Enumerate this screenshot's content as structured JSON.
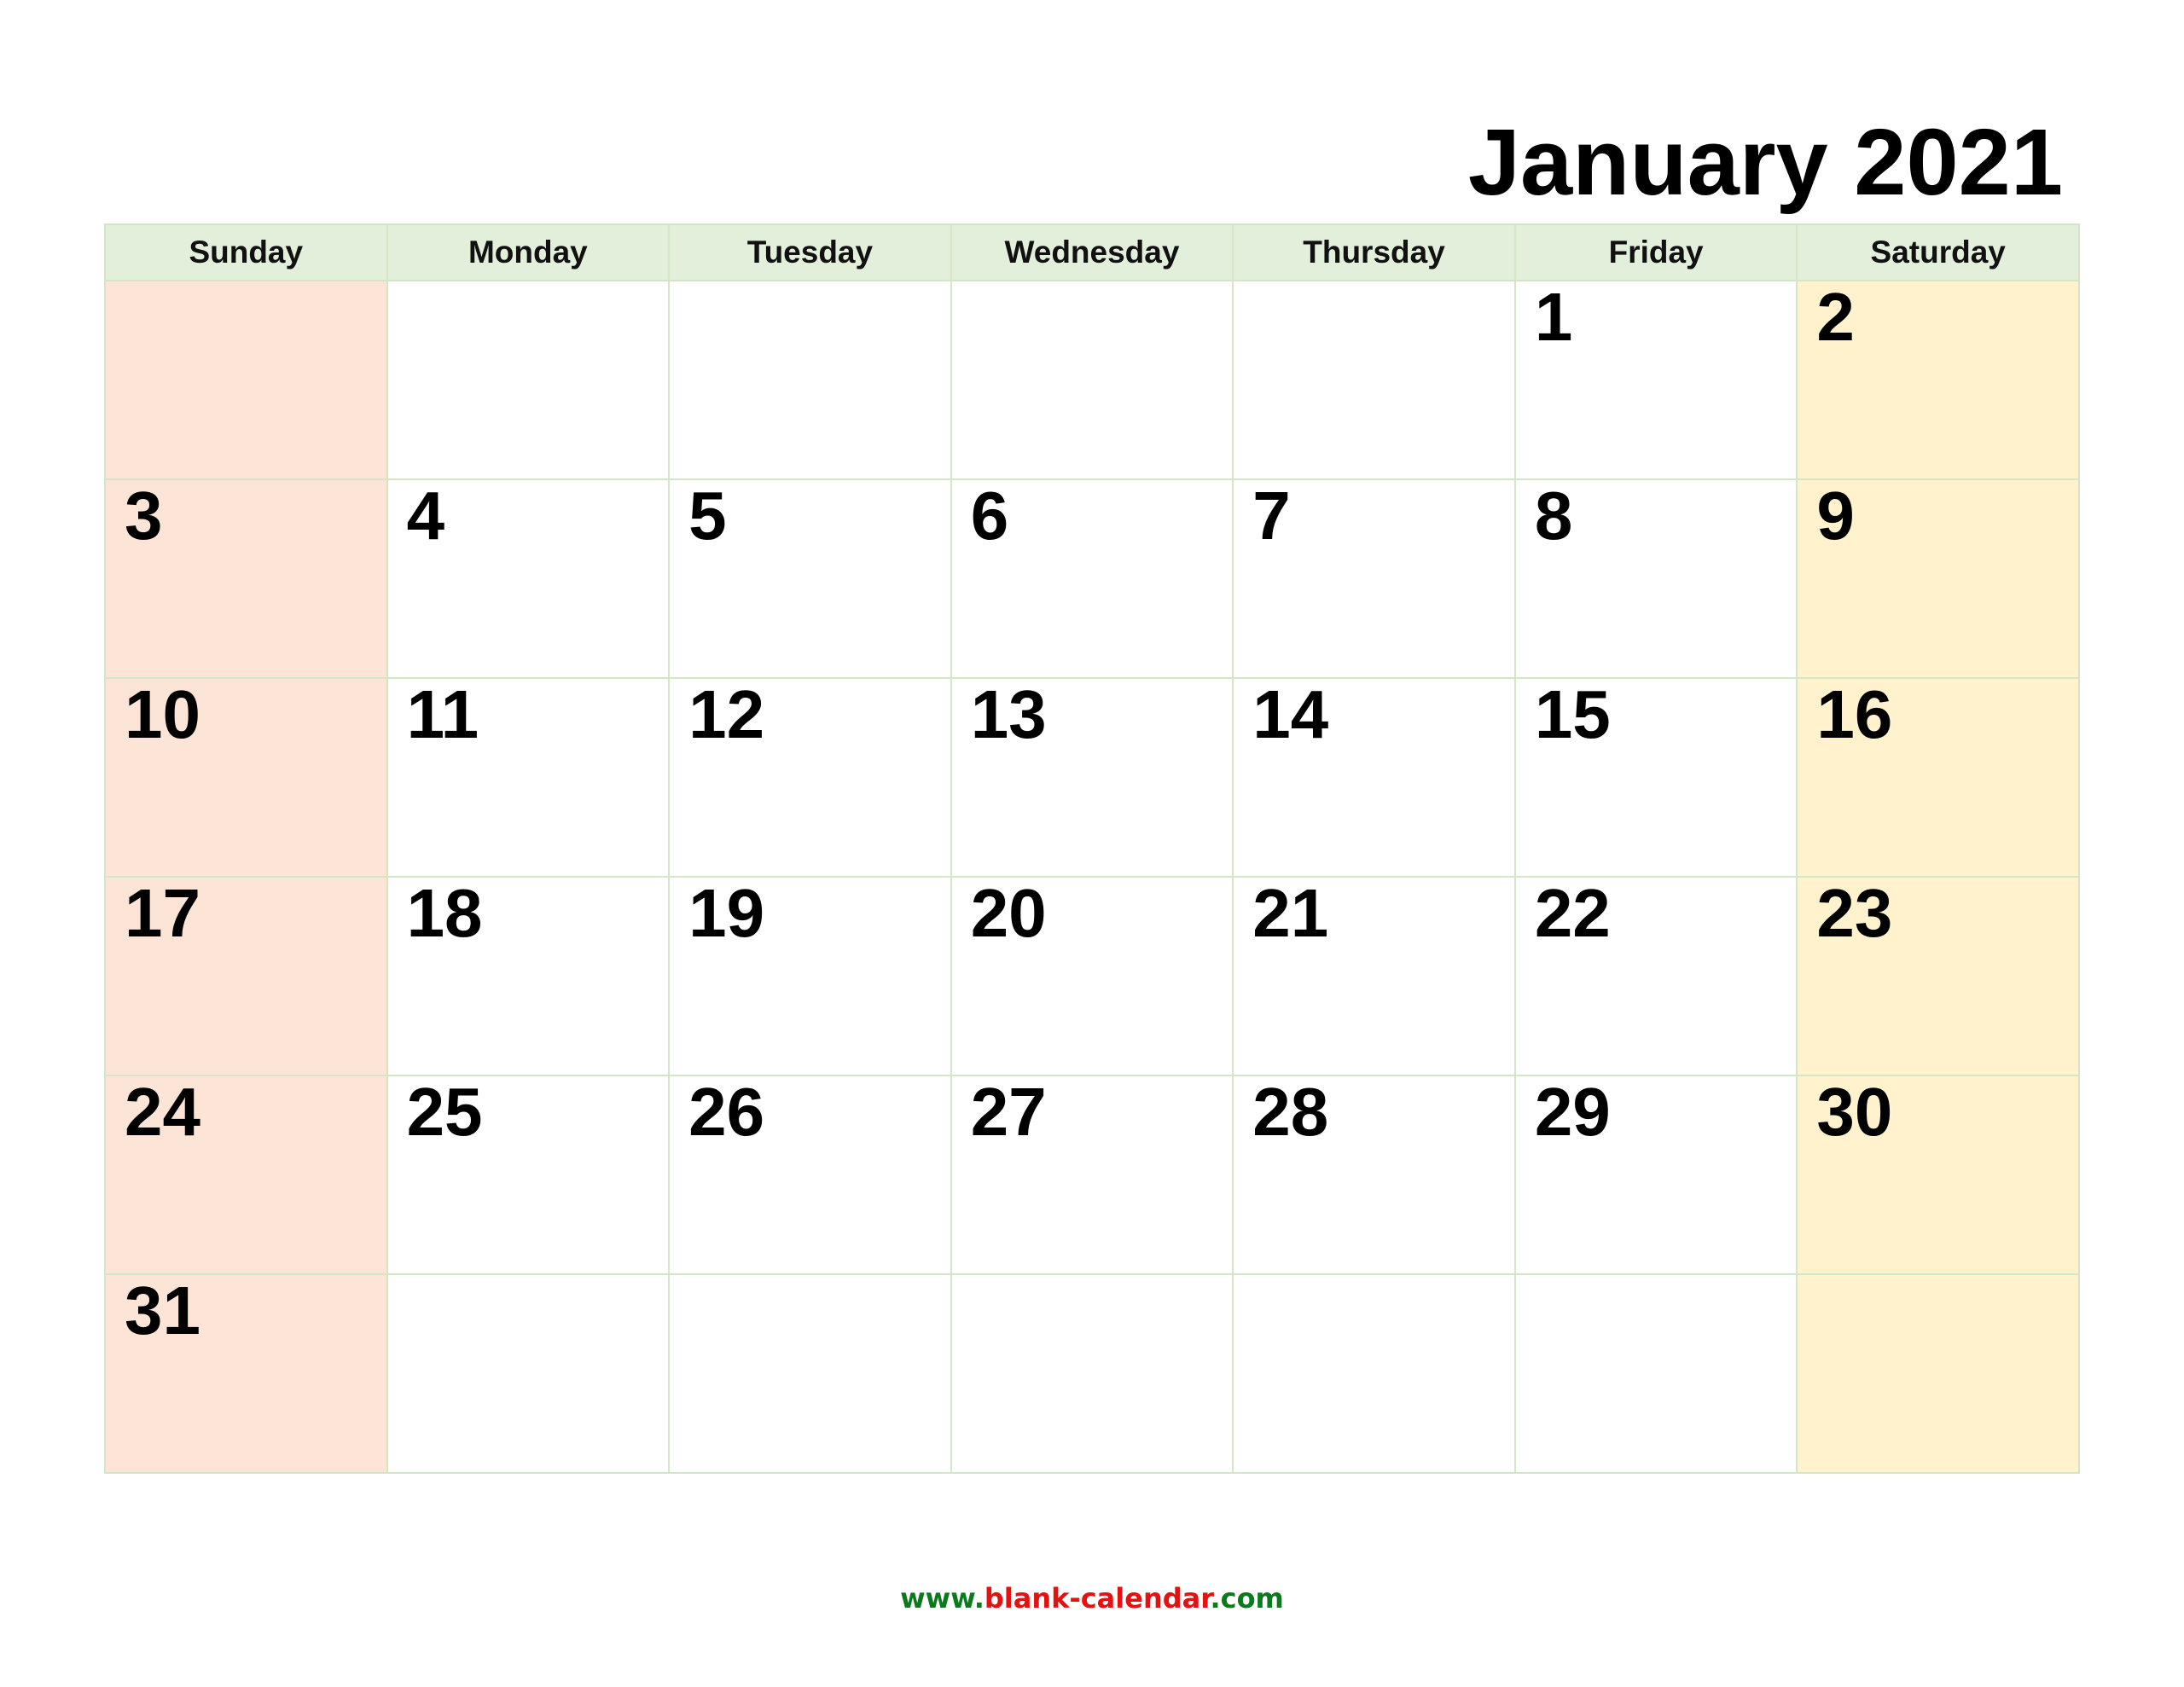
{
  "title": "January 2021",
  "weekdays": [
    "Sunday",
    "Monday",
    "Tuesday",
    "Wednesday",
    "Thursday",
    "Friday",
    "Saturday"
  ],
  "weeks": [
    [
      "",
      "",
      "",
      "",
      "",
      "1",
      "2"
    ],
    [
      "3",
      "4",
      "5",
      "6",
      "7",
      "8",
      "9"
    ],
    [
      "10",
      "11",
      "12",
      "13",
      "14",
      "15",
      "16"
    ],
    [
      "17",
      "18",
      "19",
      "20",
      "21",
      "22",
      "23"
    ],
    [
      "24",
      "25",
      "26",
      "27",
      "28",
      "29",
      "30"
    ],
    [
      "31",
      "",
      "",
      "",
      "",
      "",
      ""
    ]
  ],
  "colors": {
    "header_bg": "#e2efda",
    "sunday_bg": "#fce4d6",
    "saturday_bg": "#fff2cc",
    "grid_border": "#d4e6c8",
    "footer_green": "#0b7a1c",
    "footer_red": "#e3110f"
  },
  "footer": {
    "prefix": "www.",
    "name": "blank-calendar",
    "suffix": ".com"
  }
}
